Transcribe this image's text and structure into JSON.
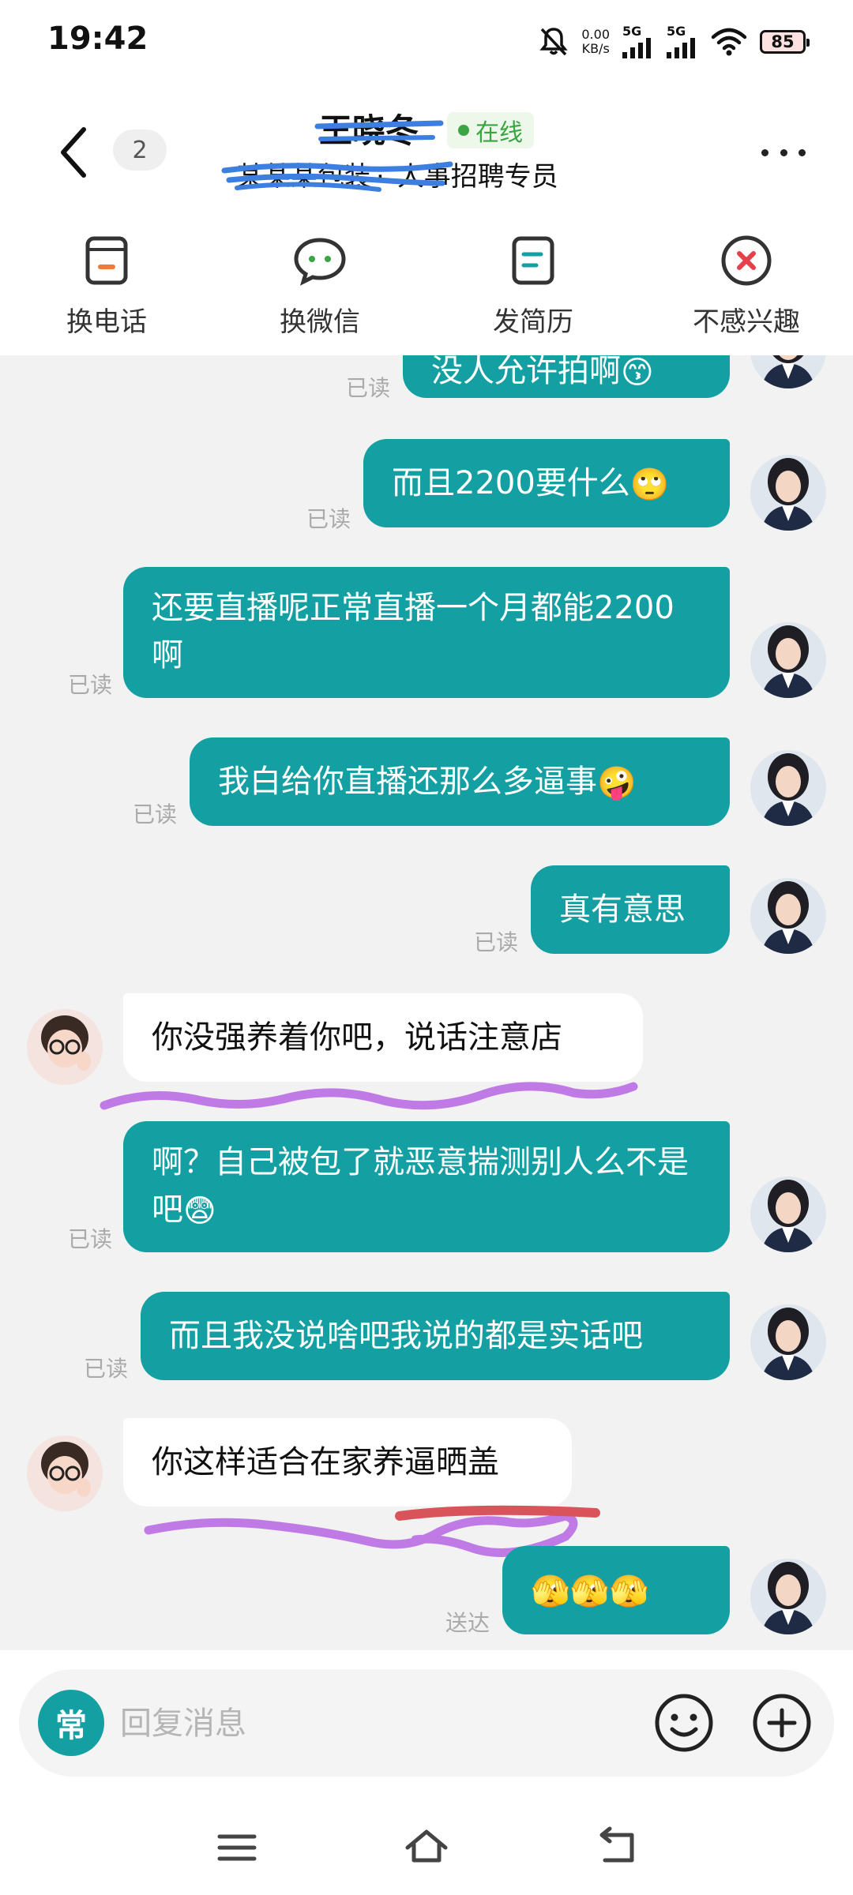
{
  "status_bar": {
    "time": "19:42",
    "net_speed_value": "0.00",
    "net_speed_unit": "KB/s",
    "signal_1": "5G",
    "signal_2": "5G",
    "battery": "85"
  },
  "header": {
    "unread_count": "2",
    "contact_name": "王晓冬",
    "online_status": "在线",
    "company": "某某某包装",
    "position": "人事招聘专员"
  },
  "actions": [
    {
      "label": "换电话",
      "icon": "phone-card-icon"
    },
    {
      "label": "换微信",
      "icon": "wechat-bubble-icon"
    },
    {
      "label": "发简历",
      "icon": "resume-doc-icon"
    },
    {
      "label": "不感兴趣",
      "icon": "not-interested-icon"
    }
  ],
  "messages": [
    {
      "side": "me",
      "text": "没人允许拍啊",
      "emoji": "😙",
      "status": "已读"
    },
    {
      "side": "me",
      "text": "而且2200要什么",
      "emoji": "🙄",
      "status": "已读"
    },
    {
      "side": "me",
      "text": "还要直播呢正常直播一个月都能2200啊",
      "emoji": "",
      "status": "已读"
    },
    {
      "side": "me",
      "text": "我白给你直播还那么多逼事",
      "emoji": "🤪",
      "status": "已读"
    },
    {
      "side": "me",
      "text": "真有意思",
      "emoji": "",
      "status": "已读"
    },
    {
      "side": "them",
      "text": "你没强养着你吧，说话注意店",
      "emoji": ""
    },
    {
      "side": "me",
      "text": "啊？自己被包了就恶意揣测别人么不是吧",
      "emoji": "😨",
      "status": "已读"
    },
    {
      "side": "me",
      "text": "而且我没说啥吧我说的都是实话吧",
      "emoji": "",
      "status": "已读"
    },
    {
      "side": "them",
      "text": "你这样适合在家养逼晒盖",
      "emoji": ""
    },
    {
      "side": "me",
      "text": "",
      "emoji": "🫣🫣🫣",
      "status": "送达"
    }
  ],
  "input": {
    "quick_label": "常",
    "placeholder": "回复消息"
  },
  "colors": {
    "accent": "#14a0a2",
    "online_green": "#3aa542",
    "chat_background": "#f2f2f2"
  }
}
